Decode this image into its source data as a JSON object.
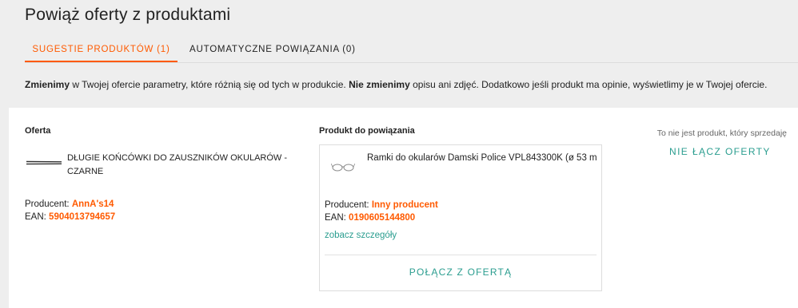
{
  "header": {
    "title": "Powiąż oferty z produktami"
  },
  "tabs": [
    {
      "label": "SUGESTIE PRODUKTÓW (1)",
      "active": true
    },
    {
      "label": "AUTOMATYCZNE POWIĄZANIA (0)",
      "active": false
    }
  ],
  "info": {
    "bold1": "Zmienimy",
    "text1": " w Twojej ofercie parametry, które różnią się od tych w produkcie. ",
    "bold2": "Nie zmienimy",
    "text2": " opisu ani zdjęć. Dodatkowo jeśli produkt ma opinie, wyświetlimy je w Twojej ofercie."
  },
  "offer": {
    "heading": "Oferta",
    "name": "DŁUGIE KOŃCÓWKI DO ZAUSZNIKÓW OKULARÓW - CZARNE",
    "producer_label": "Producent: ",
    "producer": "AnnA's14",
    "ean_label": "EAN: ",
    "ean": "5904013794657"
  },
  "product": {
    "heading": "Produkt do powiązania",
    "name": "Ramki do okularów Damski Police VPL843300K (ø 53 m",
    "producer_label": "Producent: ",
    "producer": "Inny producent",
    "ean_label": "EAN: ",
    "ean": "0190605144800",
    "details_link": "zobacz szczegóły",
    "connect_button": "POŁĄCZ Z OFERTĄ"
  },
  "side": {
    "hint": "To nie jest produkt, który sprzedaję",
    "dont_link_button": "NIE ŁĄCZ OFERTY"
  },
  "colors": {
    "accent": "#ff5a00",
    "link": "#2a9d8f"
  },
  "icons": {
    "offer_image": "temple-tips-image",
    "product_image": "glasses-frame-image"
  }
}
